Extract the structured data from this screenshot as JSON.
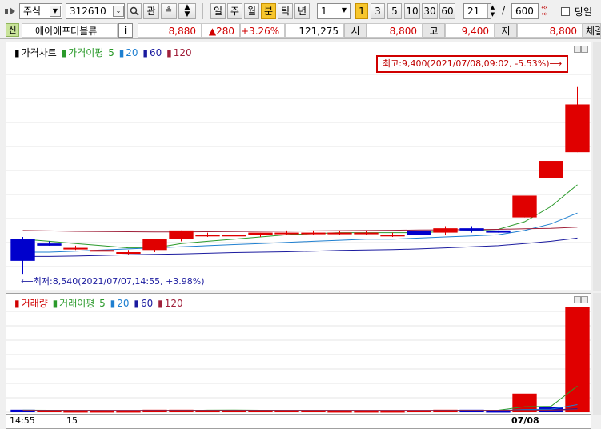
{
  "toolbar": {
    "market_select": "주식",
    "code_input": "312610",
    "interest_label": "관",
    "periods": [
      "일",
      "주",
      "월",
      "분",
      "틱",
      "년"
    ],
    "active_period": "분",
    "interval_value": "1",
    "interval_presets": [
      "1",
      "3",
      "5",
      "10",
      "30",
      "60"
    ],
    "active_preset": "1",
    "count_value": "21",
    "total_value": "600",
    "same_day_label": "당일"
  },
  "quote": {
    "badge": "신",
    "stock_name": "에이에프더블류",
    "info_label": "i",
    "price": "8,880",
    "change": "▲280",
    "change_pct": "+3.26%",
    "volume": "121,275",
    "open_label": "시",
    "open": "8,800",
    "high_label": "고",
    "high": "9,400",
    "low_label": "저",
    "low": "8,800",
    "trade_label": "체결강"
  },
  "price_panel": {
    "legend": {
      "series_label": "가격차트",
      "ma_label": "가격이평",
      "ma_values": [
        "5",
        "20",
        "60",
        "120"
      ]
    },
    "max_annotation": "최고:9,400(2021/07/08,09:02, -5.53%)⟶",
    "min_annotation": "⟵최저:8,540(2021/07/07,14:55, +3.98%)"
  },
  "volume_panel": {
    "legend": {
      "series_label": "거래량",
      "ma_label": "거래이평",
      "ma_values": [
        "5",
        "20",
        "60",
        "120"
      ]
    }
  },
  "x_axis": {
    "labels": [
      "14:55",
      "15",
      "07/08"
    ]
  },
  "colors": {
    "up": "#e00000",
    "down": "#0000cc",
    "ma5": "#2b9a2b",
    "ma20": "#1e7fd0",
    "ma60": "#1b1b9f",
    "ma120": "#a0203a"
  },
  "chart_data": [
    {
      "type": "candlestick",
      "title": "가격차트",
      "unit": "KRW",
      "ylim": [
        8500,
        9400
      ],
      "x_labels": [
        "14:55",
        "15",
        "07/08"
      ],
      "candles": [
        {
          "open": 8700,
          "high": 8710,
          "low": 8540,
          "close": 8600
        },
        {
          "open": 8680,
          "high": 8690,
          "low": 8670,
          "close": 8670
        },
        {
          "open": 8660,
          "high": 8670,
          "low": 8650,
          "close": 8660
        },
        {
          "open": 8650,
          "high": 8660,
          "low": 8640,
          "close": 8650
        },
        {
          "open": 8640,
          "high": 8650,
          "low": 8630,
          "close": 8640
        },
        {
          "open": 8650,
          "high": 8700,
          "low": 8640,
          "close": 8700
        },
        {
          "open": 8700,
          "high": 8740,
          "low": 8690,
          "close": 8740
        },
        {
          "open": 8720,
          "high": 8730,
          "low": 8710,
          "close": 8720
        },
        {
          "open": 8720,
          "high": 8730,
          "low": 8710,
          "close": 8720
        },
        {
          "open": 8720,
          "high": 8730,
          "low": 8710,
          "close": 8730
        },
        {
          "open": 8730,
          "high": 8740,
          "low": 8720,
          "close": 8730
        },
        {
          "open": 8730,
          "high": 8740,
          "low": 8720,
          "close": 8730
        },
        {
          "open": 8730,
          "high": 8740,
          "low": 8720,
          "close": 8730
        },
        {
          "open": 8730,
          "high": 8740,
          "low": 8720,
          "close": 8730
        },
        {
          "open": 8720,
          "high": 8730,
          "low": 8710,
          "close": 8720
        },
        {
          "open": 8740,
          "high": 8750,
          "low": 8720,
          "close": 8720
        },
        {
          "open": 8730,
          "high": 8760,
          "low": 8720,
          "close": 8750
        },
        {
          "open": 8750,
          "high": 8760,
          "low": 8730,
          "close": 8740
        },
        {
          "open": 8740,
          "high": 8740,
          "low": 8730,
          "close": 8730
        },
        {
          "open": 8800,
          "high": 8900,
          "low": 8800,
          "close": 8900
        },
        {
          "open": 8980,
          "high": 9070,
          "low": 8980,
          "close": 9060
        },
        {
          "open": 9100,
          "high": 9400,
          "low": 9100,
          "close": 9320
        }
      ],
      "series": [
        {
          "name": "5",
          "values": [
            8700,
            8690,
            8680,
            8670,
            8660,
            8660,
            8680,
            8690,
            8700,
            8710,
            8720,
            8725,
            8730,
            8730,
            8730,
            8730,
            8735,
            8740,
            8745,
            8780,
            8850,
            8950
          ]
        },
        {
          "name": "20",
          "values": [
            8640,
            8640,
            8645,
            8650,
            8655,
            8660,
            8665,
            8670,
            8675,
            8680,
            8685,
            8690,
            8695,
            8700,
            8700,
            8705,
            8710,
            8715,
            8720,
            8740,
            8770,
            8820
          ]
        },
        {
          "name": "60",
          "values": [
            8620,
            8620,
            8622,
            8625,
            8628,
            8630,
            8632,
            8635,
            8638,
            8640,
            8642,
            8645,
            8648,
            8650,
            8652,
            8655,
            8660,
            8665,
            8670,
            8680,
            8690,
            8705
          ]
        },
        {
          "name": "120",
          "values": [
            8740,
            8738,
            8736,
            8735,
            8734,
            8733,
            8733,
            8734,
            8735,
            8736,
            8737,
            8738,
            8739,
            8740,
            8741,
            8742,
            8743,
            8744,
            8745,
            8748,
            8750,
            8755
          ]
        }
      ]
    },
    {
      "type": "bar",
      "title": "거래량",
      "values": [
        300,
        200,
        150,
        150,
        150,
        300,
        300,
        200,
        200,
        200,
        200,
        200,
        150,
        150,
        150,
        200,
        300,
        300,
        150,
        2200,
        600,
        12500
      ],
      "directions": [
        "down",
        "up",
        "up",
        "up",
        "up",
        "up",
        "up",
        "up",
        "up",
        "up",
        "up",
        "up",
        "up",
        "up",
        "up",
        "up",
        "up",
        "down",
        "down",
        "up",
        "down",
        "up"
      ],
      "series": [
        {
          "name": "5",
          "values": [
            250,
            240,
            220,
            200,
            180,
            190,
            210,
            250,
            260,
            240,
            220,
            210,
            200,
            190,
            180,
            180,
            200,
            230,
            240,
            650,
            700,
            3100
          ]
        },
        {
          "name": "20",
          "values": [
            200,
            200,
            200,
            200,
            200,
            200,
            200,
            200,
            200,
            200,
            200,
            200,
            200,
            200,
            200,
            200,
            200,
            210,
            210,
            320,
            350,
            900
          ]
        },
        {
          "name": "60",
          "values": [
            210,
            210,
            210,
            210,
            210,
            210,
            210,
            210,
            210,
            210,
            210,
            210,
            210,
            210,
            210,
            210,
            210,
            210,
            210,
            250,
            260,
            420
          ]
        },
        {
          "name": "120",
          "values": [
            220,
            220,
            220,
            220,
            220,
            220,
            220,
            220,
            220,
            220,
            220,
            220,
            220,
            220,
            220,
            220,
            220,
            220,
            220,
            240,
            245,
            320
          ]
        }
      ]
    }
  ]
}
